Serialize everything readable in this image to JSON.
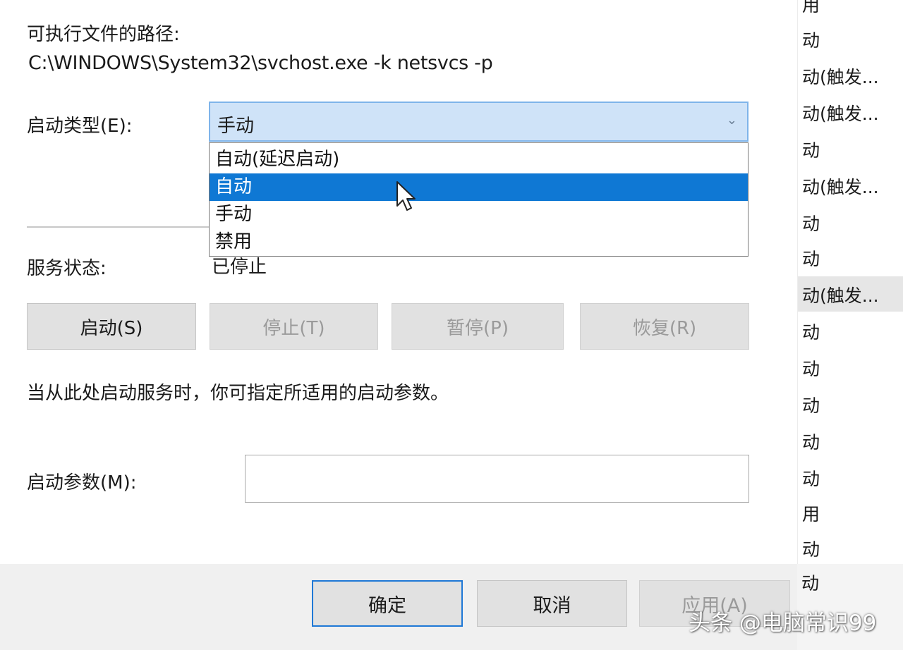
{
  "exe_path_label": "可执行文件的路径:",
  "exe_path_value": "C:\\WINDOWS\\System32\\svchost.exe -k netsvcs -p",
  "startup_type": {
    "label": "启动类型(E):",
    "selected": "手动",
    "options": [
      "自动(延迟启动)",
      "自动",
      "手动",
      "禁用"
    ],
    "highlighted_index": 1
  },
  "service_status": {
    "label": "服务状态:",
    "value": "已停止"
  },
  "service_buttons": {
    "start": "启动(S)",
    "stop": "停止(T)",
    "pause": "暂停(P)",
    "resume": "恢复(R)"
  },
  "start_params_hint": "当从此处启动服务时，你可指定所适用的启动参数。",
  "start_params": {
    "label": "启动参数(M):",
    "value": ""
  },
  "footer": {
    "ok": "确定",
    "cancel": "取消",
    "apply": "应用(A)"
  },
  "background_list": [
    "用",
    "动",
    "动(触发...",
    "动(触发...",
    "动",
    "动(触发...",
    "动",
    "动",
    "动(触发...",
    "动",
    "动",
    "动",
    "动",
    "动",
    "用",
    "动",
    "动"
  ],
  "watermark": "头条 @电脑常识99",
  "colors": {
    "selection": "#0f78d4",
    "combo_bg": "#cfe3f8",
    "primary_border": "#1e78d6"
  }
}
